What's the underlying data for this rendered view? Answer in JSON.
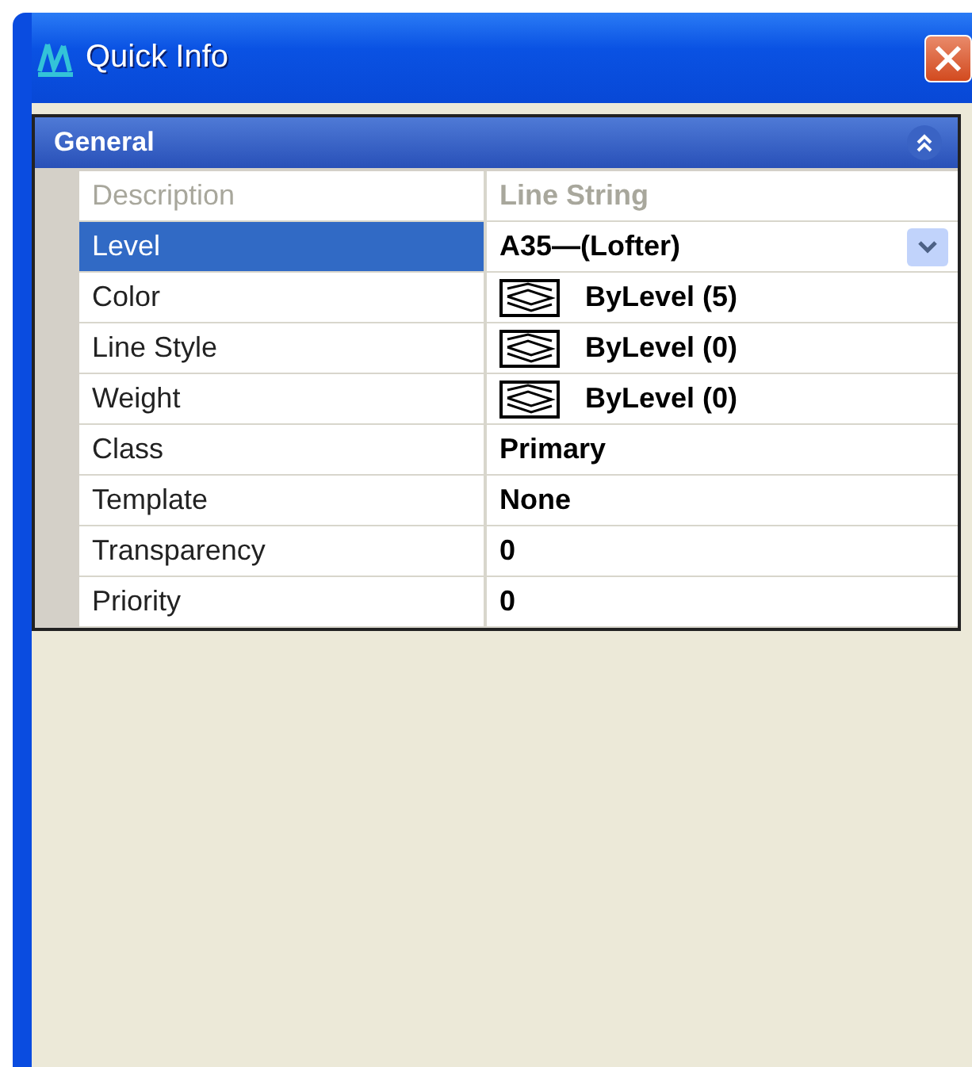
{
  "window": {
    "title": "Quick Info"
  },
  "section": {
    "title": "General",
    "expanded": true
  },
  "properties": [
    {
      "label": "Description",
      "value": "Line String",
      "kind": "text",
      "selected": false,
      "disabled": true
    },
    {
      "label": "Level",
      "value": "A35—(Lofter)",
      "kind": "dropdown",
      "selected": true,
      "disabled": false
    },
    {
      "label": "Color",
      "value": "ByLevel (5)",
      "kind": "bylevel",
      "selected": false,
      "disabled": false
    },
    {
      "label": "Line Style",
      "value": "ByLevel (0)",
      "kind": "bylevel",
      "selected": false,
      "disabled": false
    },
    {
      "label": "Weight",
      "value": "ByLevel (0)",
      "kind": "bylevel",
      "selected": false,
      "disabled": false
    },
    {
      "label": "Class",
      "value": "Primary",
      "kind": "text",
      "selected": false,
      "disabled": false
    },
    {
      "label": "Template",
      "value": "None",
      "kind": "text",
      "selected": false,
      "disabled": false
    },
    {
      "label": "Transparency",
      "value": "0",
      "kind": "text",
      "selected": false,
      "disabled": false
    },
    {
      "label": "Priority",
      "value": "0",
      "kind": "text",
      "selected": false,
      "disabled": false
    }
  ]
}
